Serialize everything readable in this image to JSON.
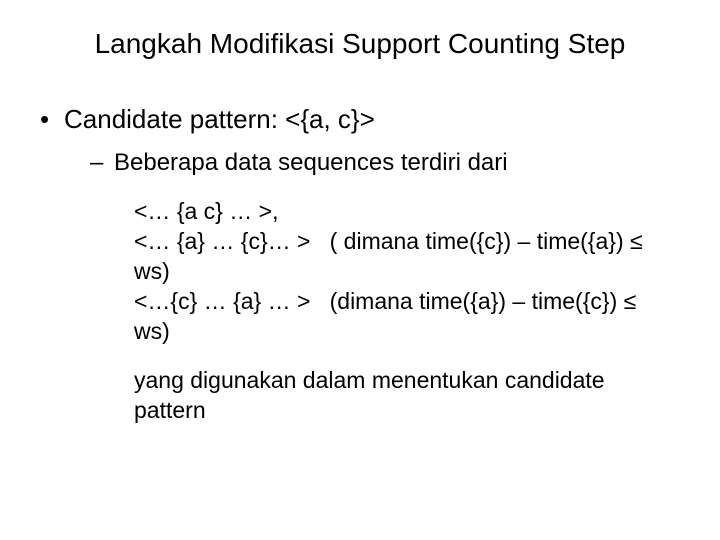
{
  "title": "Langkah Modifikasi Support Counting Step",
  "bullet1": "Candidate pattern: <{a, c}>",
  "bullet2": "Beberapa data sequences terdiri dari",
  "patterns": "<… {a c} … >,\n<… {a} … {c}… >   ( dimana time({c}) – time({a}) ≤ ws)\n<…{c} … {a} … >   (dimana time({a}) – time({c}) ≤ ws)",
  "closing": "yang digunakan  dalam menentukan candidate pattern"
}
